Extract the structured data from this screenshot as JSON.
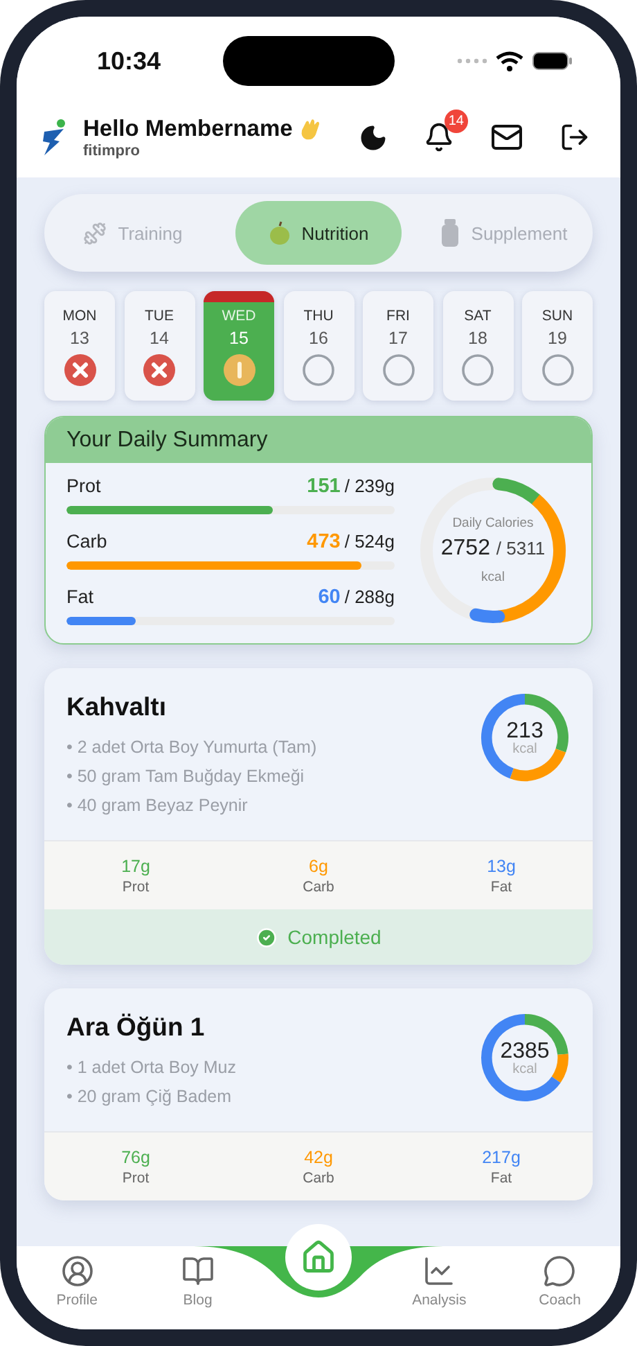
{
  "status_bar": {
    "time": "10:34"
  },
  "header": {
    "greeting": "Hello Membername",
    "brand": "fitimpro",
    "notification_count": "14"
  },
  "tabs": [
    {
      "label": "Training",
      "selected": false,
      "kind": "training"
    },
    {
      "label": "Nutrition",
      "selected": true,
      "kind": "nutrition"
    },
    {
      "label": "Supplement",
      "selected": false,
      "kind": "supplement"
    }
  ],
  "days": [
    {
      "day": "MON",
      "date": "13",
      "selected": false,
      "kind": "missed"
    },
    {
      "day": "TUE",
      "date": "14",
      "selected": false,
      "kind": "missed"
    },
    {
      "day": "WED",
      "date": "15",
      "selected": true,
      "kind": "partial"
    },
    {
      "day": "THU",
      "date": "16",
      "selected": false,
      "kind": "none"
    },
    {
      "day": "FRI",
      "date": "17",
      "selected": false,
      "kind": "none"
    },
    {
      "day": "SAT",
      "date": "18",
      "selected": false,
      "kind": "none"
    },
    {
      "day": "SUN",
      "date": "19",
      "selected": false,
      "kind": "none"
    }
  ],
  "summary": {
    "title": "Your Daily Summary",
    "macros": [
      {
        "name": "Prot",
        "value": "151",
        "target": "/ 239g",
        "level": 0.63,
        "color": "#4caf50"
      },
      {
        "name": "Carb",
        "value": "473",
        "target": "/ 524g",
        "level": 0.9,
        "color": "#ff9800"
      },
      {
        "name": "Fat",
        "value": "60",
        "target": "/ 288g",
        "level": 0.21,
        "color": "#4285f4"
      }
    ],
    "calories": {
      "label": "Daily Calories",
      "value": "2752",
      "target": "/ 5311",
      "unit": "kcal"
    }
  },
  "meals": [
    {
      "title": "Kahvaltı",
      "items": [
        "• 2 adet Orta Boy Yumurta (Tam)",
        "• 50 gram Tam Buğday Ekmeği",
        "• 40 gram Beyaz Peynir"
      ],
      "kcal": "213",
      "unit": "kcal",
      "macros": [
        {
          "value": "17g",
          "label": "Prot",
          "color": "#4caf50"
        },
        {
          "value": "6g",
          "label": "Carb",
          "color": "#ff9800"
        },
        {
          "value": "13g",
          "label": "Fat",
          "color": "#4285f4"
        }
      ],
      "completed": true,
      "status_label": "Completed"
    },
    {
      "title": "Ara Öğün 1",
      "items": [
        "• 1 adet Orta Boy Muz",
        "• 20 gram Çiğ Badem"
      ],
      "kcal": "2385",
      "unit": "kcal",
      "macros": [
        {
          "value": "76g",
          "label": "Prot",
          "color": "#4caf50"
        },
        {
          "value": "42g",
          "label": "Carb",
          "color": "#ff9800"
        },
        {
          "value": "217g",
          "label": "Fat",
          "color": "#4285f4"
        }
      ],
      "completed": false
    }
  ],
  "bottom_nav": [
    {
      "label": "Profile",
      "kind": "profile"
    },
    {
      "label": "Blog",
      "kind": "blog"
    },
    {
      "kind": "home"
    },
    {
      "label": "Analysis",
      "kind": "analysis"
    },
    {
      "label": "Coach",
      "kind": "coach"
    }
  ]
}
